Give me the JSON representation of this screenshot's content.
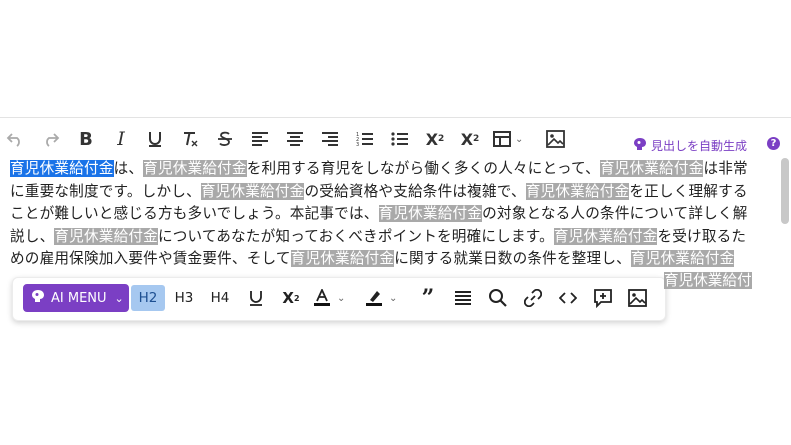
{
  "toolbar": {
    "generate_heading_label": "見出しを自動生成",
    "help_label": "?"
  },
  "content": {
    "lines": [
      [
        {
          "t": "育児休業給付金",
          "s": "sel"
        },
        {
          "t": "は、",
          "s": ""
        },
        {
          "t": "育児休業給付金",
          "s": "hl"
        },
        {
          "t": "を利用する育児をしながら働く多くの人々にとって、",
          "s": ""
        },
        {
          "t": "育児休業給付金",
          "s": "hl"
        },
        {
          "t": "は非常",
          "s": ""
        }
      ],
      [
        {
          "t": "に重要な制度です。しかし、",
          "s": ""
        },
        {
          "t": "育児休業給付金",
          "s": "hl"
        },
        {
          "t": "の受給資格や支給条件は複雑で、",
          "s": ""
        },
        {
          "t": "育児休業給付金",
          "s": "hl"
        },
        {
          "t": "を正しく理解する",
          "s": ""
        }
      ],
      [
        {
          "t": "ことが難しいと感じる方も多いでしょう。本記事では、",
          "s": ""
        },
        {
          "t": "育児休業給付金",
          "s": "hl"
        },
        {
          "t": "の対象となる人の条件について詳しく解",
          "s": ""
        }
      ],
      [
        {
          "t": "説し、",
          "s": ""
        },
        {
          "t": "育児休業給付金",
          "s": "hl"
        },
        {
          "t": "についてあなたが知っておくべきポイントを明確にします。",
          "s": ""
        },
        {
          "t": "育児休業給付金",
          "s": "hl"
        },
        {
          "t": "を受け取るた",
          "s": ""
        }
      ],
      [
        {
          "t": "めの雇用保険加入要件や賃金要件、そして",
          "s": ""
        },
        {
          "t": "育児休業給付金",
          "s": "hl"
        },
        {
          "t": "に関する就業日数の条件を整理し、",
          "s": ""
        },
        {
          "t": "育児休業給付金",
          "s": "hl"
        }
      ]
    ],
    "partial_line": "育児休業給付"
  },
  "floating_toolbar": {
    "ai_menu_label": "AI MENU",
    "h2_label": "H2",
    "h3_label": "H3",
    "h4_label": "H4"
  },
  "colors": {
    "accent": "#7b3fc4",
    "selection": "#1a73e8",
    "highlight": "#a9a9a9",
    "active_heading": "#a6c8f0"
  }
}
